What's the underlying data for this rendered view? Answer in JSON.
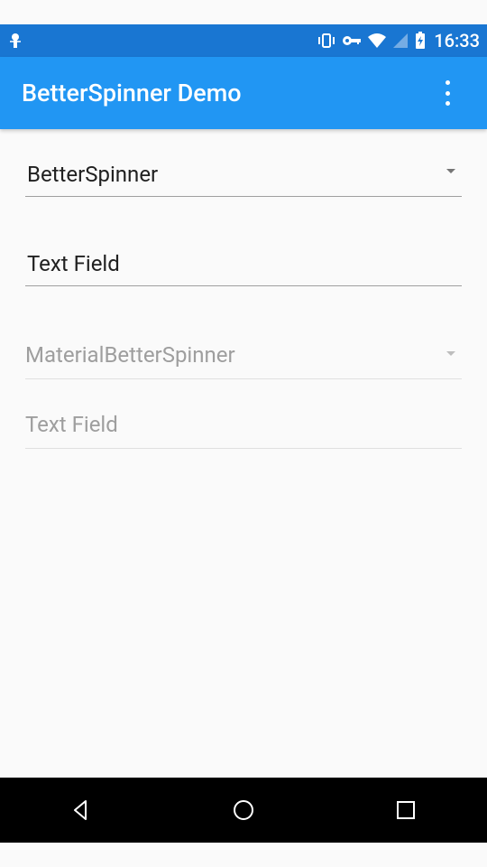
{
  "status": {
    "time": "16:33"
  },
  "appbar": {
    "title": "BetterSpinner Demo"
  },
  "fields": {
    "spinner1": {
      "value": "BetterSpinner"
    },
    "text1": {
      "value": "Text Field"
    },
    "spinner2": {
      "placeholder": "MaterialBetterSpinner"
    },
    "text2": {
      "placeholder": "Text Field"
    }
  }
}
